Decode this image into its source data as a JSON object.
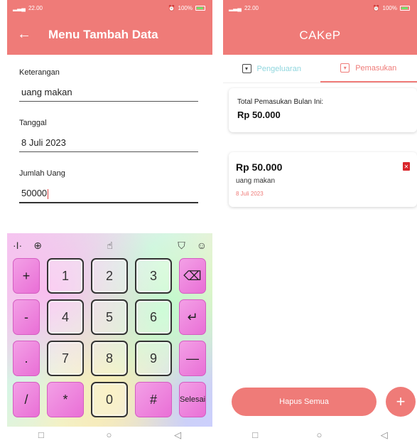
{
  "colors": {
    "accent": "#ef7b78",
    "tab_inactive": "#8fd6de",
    "delete": "#d9262b"
  },
  "left_screen": {
    "status": {
      "time": "22.00",
      "battery": "100%"
    },
    "title": "Menu Tambah Data",
    "back_icon": "arrow-left-icon",
    "fields": {
      "keterangan": {
        "label": "Keterangan",
        "value": "uang makan"
      },
      "tanggal": {
        "label": "Tanggal",
        "value": "8 Juli 2023"
      },
      "jumlah": {
        "label": "Jumlah Uang",
        "value": "50000"
      }
    },
    "keyboard": {
      "rows": [
        [
          "+",
          "1",
          "2",
          "3",
          "⌫"
        ],
        [
          "-",
          "4",
          "5",
          "6",
          "↵"
        ],
        [
          ".",
          "7",
          "8",
          "9",
          "—"
        ],
        [
          "/",
          "*",
          "0",
          "#",
          "Selesai"
        ]
      ]
    },
    "nav": {
      "square": "□",
      "circle": "○",
      "back": "◁"
    }
  },
  "right_screen": {
    "status": {
      "time": "22.00",
      "battery": "100%"
    },
    "title": "CAKeP",
    "tabs": {
      "pengeluaran": "Pengeluaran",
      "pemasukan": "Pemasukan"
    },
    "total": {
      "label": "Total Pemasukan Bulan Ini:",
      "value": "Rp 50.000"
    },
    "item": {
      "amount": "Rp 50.000",
      "description": "uang makan",
      "date": "8 Juli 2023"
    },
    "hapus_label": "Hapus Semua",
    "fab_label": "+",
    "nav": {
      "square": "□",
      "circle": "○",
      "back": "◁"
    }
  }
}
